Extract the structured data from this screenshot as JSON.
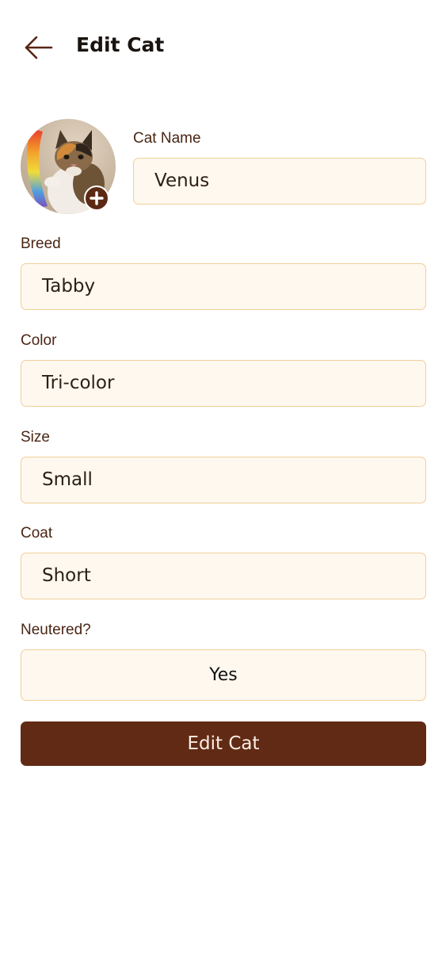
{
  "header": {
    "title": "Edit Cat",
    "back_icon": "arrow-left-icon"
  },
  "photo": {
    "add_icon": "plus-icon"
  },
  "form": {
    "cat_name": {
      "label": "Cat Name",
      "value": "Venus"
    },
    "breed": {
      "label": "Breed",
      "value": "Tabby"
    },
    "color": {
      "label": "Color",
      "value": "Tri-color"
    },
    "size": {
      "label": "Size",
      "value": "Small"
    },
    "coat": {
      "label": "Coat",
      "value": "Short"
    },
    "neutered": {
      "label": "Neutered?",
      "value": "Yes"
    }
  },
  "submit_label": "Edit Cat",
  "colors": {
    "primary": "#612a14",
    "field_background": "#fff8ef",
    "field_border": "#f1cf99",
    "label_text": "#4a2614"
  }
}
